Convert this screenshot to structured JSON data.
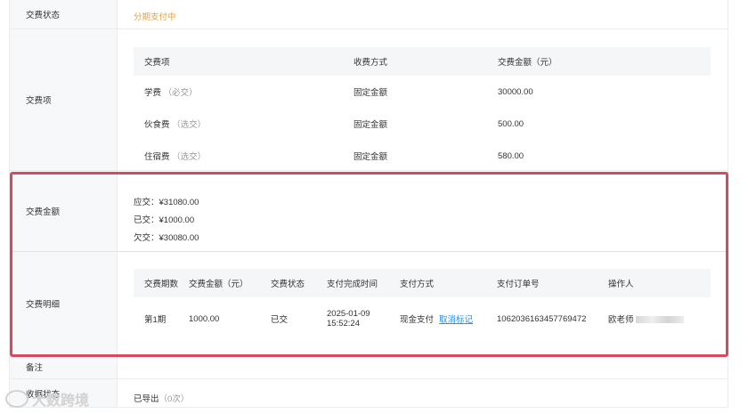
{
  "status": {
    "label": "交费状态",
    "value": "分期支付中"
  },
  "fee_items": {
    "label": "交费项",
    "headers": [
      "交费项",
      "收费方式",
      "交费金额（元）"
    ],
    "rows": [
      {
        "name": "学费",
        "tag": "（必交）",
        "method": "固定金额",
        "amount": "30000.00"
      },
      {
        "name": "伙食费",
        "tag": "（选交）",
        "method": "固定金额",
        "amount": "500.00"
      },
      {
        "name": "住宿费",
        "tag": "（选交）",
        "method": "固定金额",
        "amount": "580.00"
      }
    ]
  },
  "amount": {
    "label": "交费金额",
    "due": "应交：¥31080.00",
    "paid": "已交：¥1000.00",
    "owed": "欠交：¥30080.00"
  },
  "detail": {
    "label": "交费明细",
    "headers": [
      "交费期数",
      "交费金额（元）",
      "交费状态",
      "支付完成时间",
      "支付方式",
      "支付订单号",
      "操作人"
    ],
    "rows": [
      {
        "period": "第1期",
        "amount": "1000.00",
        "status": "已交",
        "time_date": "2025-01-09",
        "time_clock": "15:52:24",
        "method": "现金支付",
        "cancel_link": "取消标记",
        "order_no": "1062036163457769472",
        "operator": "欧老师"
      }
    ]
  },
  "remark": {
    "label": "备注"
  },
  "export": {
    "label": "收据状态",
    "value": "已导出",
    "count": "（0次）"
  },
  "watermark": {
    "text": "大数跨境"
  },
  "colors": {
    "status_orange": "#f0a03a",
    "paid_green": "#4caf50",
    "link_blue": "#2f8fe0",
    "highlight_red": "#d9485e"
  }
}
